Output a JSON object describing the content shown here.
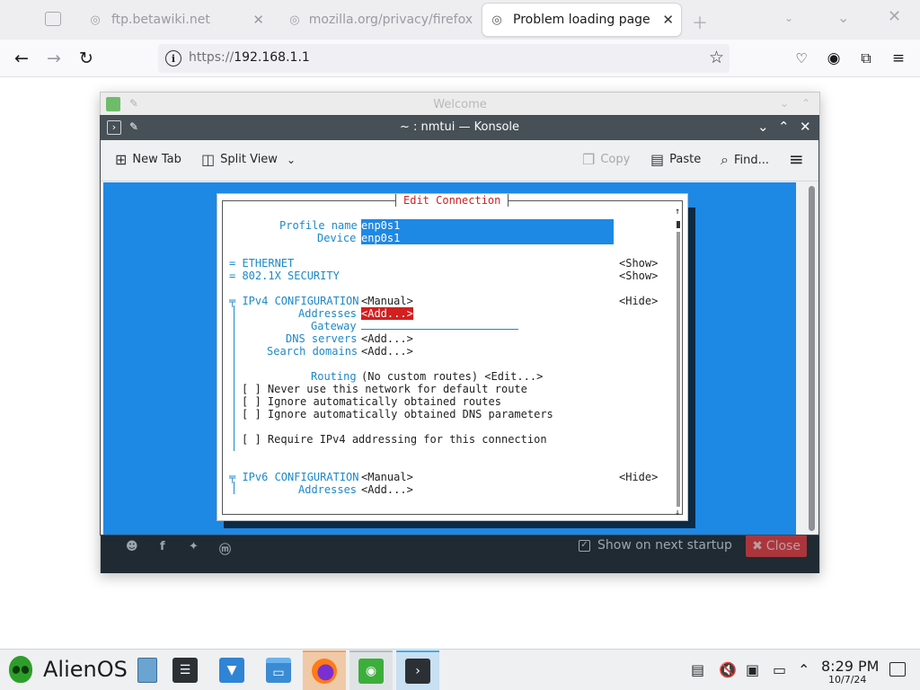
{
  "browser": {
    "tabs": [
      {
        "label": "ftp.betawiki.net",
        "icon": "globe-icon",
        "active": false
      },
      {
        "label": "mozilla.org/privacy/firefox",
        "icon": "globe-icon",
        "active": false
      },
      {
        "label": "Problem loading page",
        "icon": "globe-icon",
        "active": true
      }
    ],
    "url_proto": "https://",
    "url_host": "192.168.1.1"
  },
  "welcome": {
    "title": "Welcome",
    "show_startup": "Show on next startup",
    "close": "Close"
  },
  "konsole": {
    "title": "~ : nmtui — Konsole",
    "toolbar": {
      "new_tab": "New Tab",
      "split_view": "Split View",
      "copy": "Copy",
      "paste": "Paste",
      "find": "Find..."
    }
  },
  "nmtui": {
    "dialog_title": "Edit Connection",
    "profile_name_label": "Profile name",
    "profile_name_value": "enp0s1",
    "device_label": "Device",
    "device_value": "enp0s1",
    "ethernet": "ETHERNET",
    "security": "802.1X SECURITY",
    "show": "<Show>",
    "hide": "<Hide>",
    "ipv4_header": "IPv4 CONFIGURATION",
    "ipv6_header": "IPv6 CONFIGURATION",
    "manual": "<Manual>",
    "addresses_label": "Addresses",
    "add": "<Add...>",
    "gateway_label": "Gateway",
    "dns_label": "DNS servers",
    "search_label": "Search domains",
    "routing_label": "Routing",
    "routing_value": "(No custom routes) <Edit...>",
    "cb1": "[ ] Never use this network for default route",
    "cb2": "[ ] Ignore automatically obtained routes",
    "cb3": "[ ] Ignore automatically obtained DNS parameters",
    "cb4": "[ ] Require IPv4 addressing for this connection"
  },
  "taskbar": {
    "start_label": "AlienOS",
    "time": "8:29 PM",
    "date": "10/7/24"
  }
}
